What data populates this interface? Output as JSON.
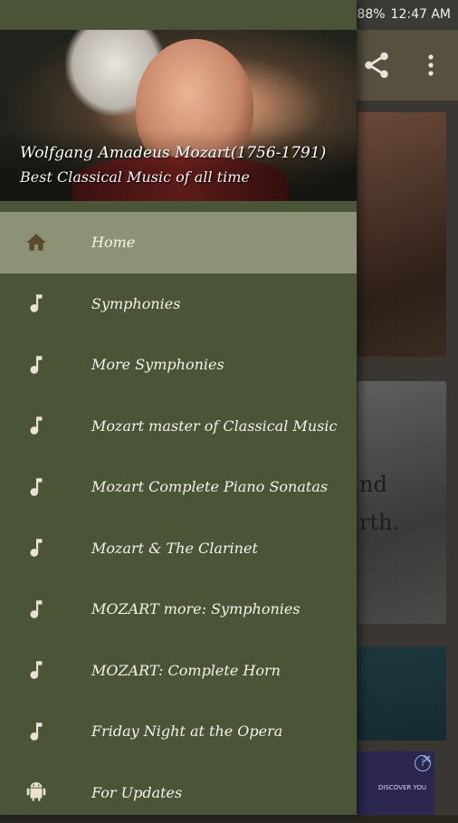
{
  "status_bar": {
    "battery_percent": "88%",
    "time": "12:47 AM",
    "colors": {
      "battery": "#3ec14a"
    }
  },
  "drawer": {
    "header": {
      "title": "Wolfgang Amadeus Mozart(1756-1791)",
      "subtitle": "Best Classical Music of all time"
    },
    "menu": [
      {
        "label": "Home",
        "icon": "home-icon",
        "active": true
      },
      {
        "label": "Symphonies",
        "icon": "music-note-icon"
      },
      {
        "label": "More Symphonies",
        "icon": "music-note-icon"
      },
      {
        "label": "Mozart master of Classical Music",
        "icon": "music-note-icon"
      },
      {
        "label": "Mozart Complete Piano Sonatas",
        "icon": "music-note-icon"
      },
      {
        "label": "Mozart & The Clarinet",
        "icon": "music-note-icon"
      },
      {
        "label": "MOZART more: Symphonies",
        "icon": "music-note-icon"
      },
      {
        "label": "MOZART: Complete Horn",
        "icon": "music-note-icon"
      },
      {
        "label": "Friday Night at the Opera",
        "icon": "music-note-icon"
      },
      {
        "label": "For Updates",
        "icon": "android-icon"
      }
    ],
    "colors": {
      "background": "#4a5538",
      "active_item": "#8b9275"
    }
  },
  "background": {
    "card2_text": [
      "nd",
      "rth."
    ],
    "ad_text": "DISCOVER YOU"
  }
}
